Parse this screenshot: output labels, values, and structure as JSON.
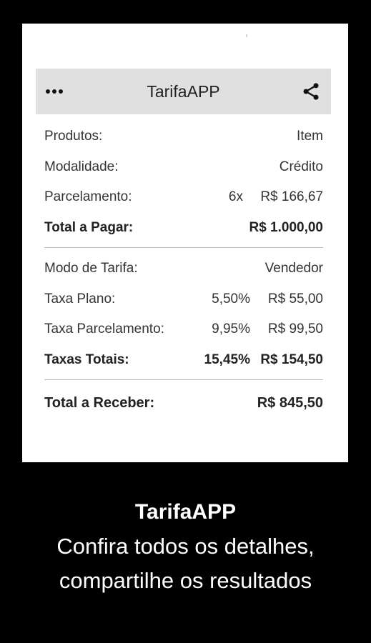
{
  "app": {
    "title": "TarifaAPP"
  },
  "summary": {
    "products_label": "Produtos:",
    "products_value": "Item",
    "modality_label": "Modalidade:",
    "modality_value": "Crédito",
    "installment_label": "Parcelamento:",
    "installment_count": "6x",
    "installment_value": "R$ 166,67",
    "total_pay_label": "Total a Pagar:",
    "total_pay_value": "R$ 1.000,00"
  },
  "fees": {
    "mode_label": "Modo de Tarifa:",
    "mode_value": "Vendedor",
    "plan_label": "Taxa Plano:",
    "plan_pct": "5,50%",
    "plan_value": "R$ 55,00",
    "installment_label": "Taxa Parcelamento:",
    "installment_pct": "9,95%",
    "installment_value": "R$ 99,50",
    "total_label": "Taxas Totais:",
    "total_pct": "15,45%",
    "total_value": "R$ 154,50"
  },
  "receive": {
    "label": "Total a Receber:",
    "value": "R$ 845,50"
  },
  "caption": {
    "title": "TarifaAPP",
    "line1": "Confira todos os detalhes,",
    "line2": "compartilhe os resultados"
  },
  "icons": {
    "menu": "more-horizontal-icon",
    "share": "share-icon"
  },
  "colors": {
    "appbar": "#e0e0e0",
    "background": "#000000",
    "card": "#ffffff"
  }
}
